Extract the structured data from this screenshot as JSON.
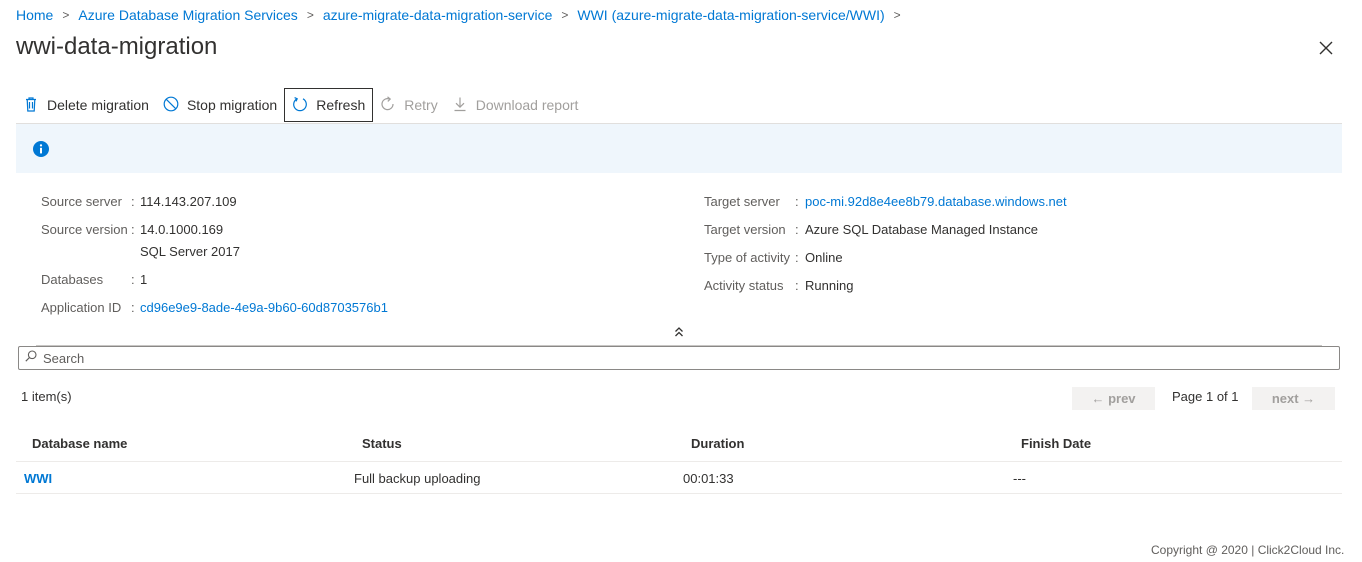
{
  "breadcrumb": {
    "items": [
      "Home",
      "Azure Database Migration Services",
      "azure-migrate-data-migration-service",
      "WWI (azure-migrate-data-migration-service/WWI)"
    ]
  },
  "page": {
    "title": "wwi-data-migration"
  },
  "toolbar": {
    "delete_label": "Delete migration",
    "stop_label": "Stop migration",
    "refresh_label": "Refresh",
    "retry_label": "Retry",
    "download_label": "Download report"
  },
  "properties": {
    "left": {
      "source_server_label": "Source server",
      "source_server_value": "114.143.207.109",
      "source_version_label": "Source version",
      "source_version_value": "14.0.1000.169",
      "source_version_value2": "SQL Server 2017",
      "databases_label": "Databases",
      "databases_value": "1",
      "app_id_label": "Application ID",
      "app_id_value": "cd96e9e9-8ade-4e9a-9b60-60d8703576b1"
    },
    "right": {
      "target_server_label": "Target server",
      "target_server_value": "poc-mi.92d8e4ee8b79.database.windows.net",
      "target_version_label": "Target version",
      "target_version_value": "Azure SQL Database Managed Instance",
      "activity_type_label": "Type of activity",
      "activity_type_value": "Online",
      "activity_status_label": "Activity status",
      "activity_status_value": "Running"
    },
    "colon": ":"
  },
  "search": {
    "placeholder": "Search"
  },
  "list": {
    "item_count": "1 item(s)",
    "prev_label": "← prev",
    "next_label": "next →",
    "page_info": "Page 1 of 1"
  },
  "table": {
    "columns": [
      "Database name",
      "Status",
      "Duration",
      "Finish Date"
    ],
    "rows": [
      {
        "database": "WWI",
        "status": "Full backup uploading",
        "duration": "00:01:33",
        "finish": "---"
      }
    ]
  },
  "footer": {
    "text": "Copyright @ 2020 |   Click2Cloud Inc."
  },
  "colors": {
    "accent": "#0078d4",
    "info_bg": "#eff6fc"
  },
  "icons": {
    "delete": "trash-icon",
    "stop": "stop-circle-icon",
    "refresh": "refresh-icon",
    "retry": "retry-icon",
    "download": "download-icon",
    "info": "info-icon",
    "close": "close-icon",
    "collapse": "double-chevron-up-icon",
    "search": "search-icon"
  }
}
